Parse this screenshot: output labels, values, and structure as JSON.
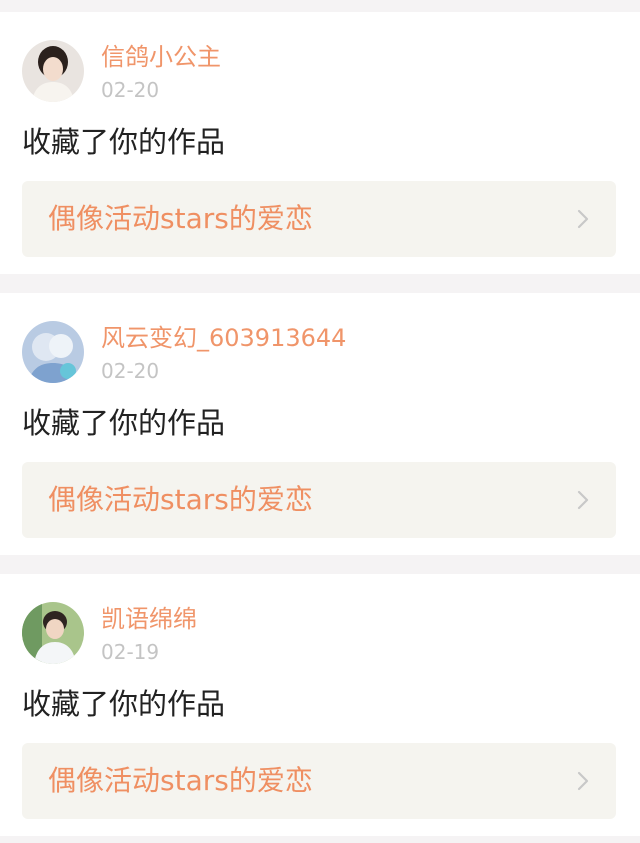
{
  "colors": {
    "page_background": "#f5f3f4",
    "card_background": "#ffffff",
    "username": "#f0956a",
    "date": "#c4c4c4",
    "action_text": "#222222",
    "link_background": "#f5f4ef",
    "link_text": "#ef8f62",
    "chevron": "#c8c8c8"
  },
  "notifications": [
    {
      "username": "信鸽小公主",
      "date": "02-20",
      "action": "收藏了你的作品",
      "work_title": "偶像活动stars的爱恋",
      "avatar_icon": "user-avatar-icon"
    },
    {
      "username": "风云变幻_603913644",
      "date": "02-20",
      "action": "收藏了你的作品",
      "work_title": "偶像活动stars的爱恋",
      "avatar_icon": "user-avatar-icon"
    },
    {
      "username": "凯语绵绵",
      "date": "02-19",
      "action": "收藏了你的作品",
      "work_title": "偶像活动stars的爱恋",
      "avatar_icon": "user-avatar-icon"
    }
  ]
}
